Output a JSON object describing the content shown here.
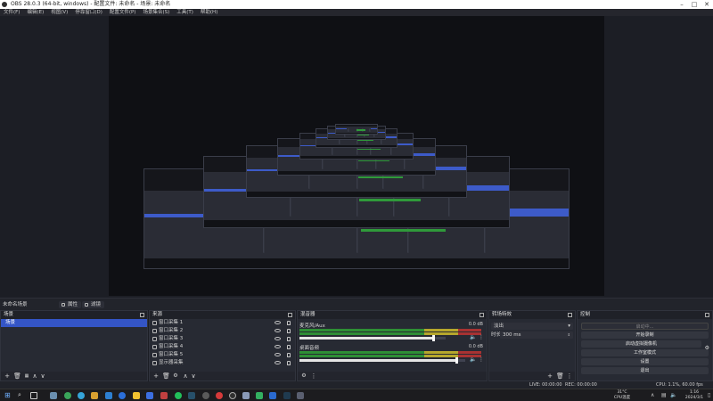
{
  "window": {
    "title": "OBS 28.0.3 (64-bit, windows) - 配置文件: 未命名 - 场景: 未命名"
  },
  "menu": [
    "文件(F)",
    "编辑(E)",
    "视图(V)",
    "停靠窗口(D)",
    "配置文件(P)",
    "场景集合(S)",
    "工具(T)",
    "帮助(H)"
  ],
  "scene_bar": {
    "current_scene": "未命名场景",
    "filters_label": "属性",
    "filter2_label": "滤镜"
  },
  "scenes": {
    "title": "场景",
    "items": [
      {
        "name": "场景",
        "selected": true
      }
    ]
  },
  "sources": {
    "title": "来源",
    "items": [
      "窗口采集 1",
      "窗口采集 2",
      "窗口采集 3",
      "窗口采集 4",
      "窗口采集 5",
      "显示器采集"
    ]
  },
  "mixer": {
    "title": "混音器",
    "channels": [
      {
        "name": "麦克风/Aux",
        "db": "0.0 dB",
        "volume": 0.92
      },
      {
        "name": "桌面音频",
        "db": "0.0 dB",
        "volume": 0.95
      }
    ]
  },
  "transitions": {
    "title": "转场特效",
    "type": "淡出",
    "duration_label": "时长",
    "duration": "300 ms"
  },
  "controls": {
    "title": "控制",
    "buttons": [
      {
        "label": "启动中...",
        "style": "empty"
      },
      {
        "label": "开始录制",
        "style": "normal"
      },
      {
        "label": "启动虚拟摄像机",
        "style": "normal"
      },
      {
        "label": "工作室模式",
        "style": "normal"
      },
      {
        "label": "设置",
        "style": "normal"
      },
      {
        "label": "退出",
        "style": "normal"
      }
    ]
  },
  "status": {
    "live": "LIVE: 00:00:00",
    "rec": "REC: 00:00:00",
    "cpu": "CPU: 1.1%, 60.00 fps"
  },
  "taskbar": {
    "weather_temp": "31°C",
    "weather_text": "CPU温度",
    "time": "1:16",
    "date": "2024/3/1"
  },
  "colors": {
    "accent": "#3455c6",
    "meter_green": "#2e8f35",
    "meter_yellow": "#b6a72c",
    "meter_red": "#a83232"
  }
}
